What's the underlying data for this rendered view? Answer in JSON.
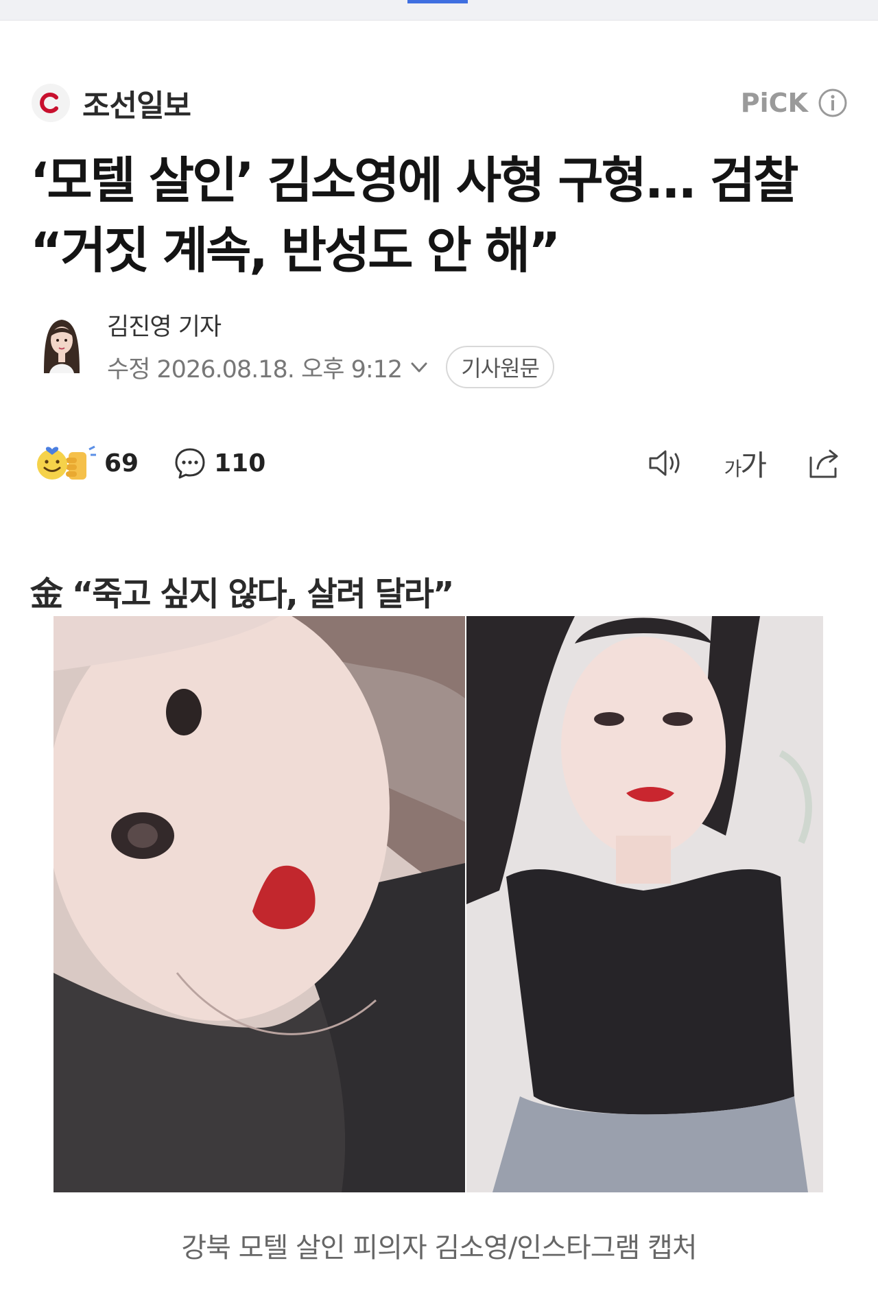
{
  "press": {
    "name": "조선일보",
    "pick_label": "PiCK"
  },
  "article": {
    "headline_line1": "‘모텔 살인’ 김소영에 사형 구형... 검찰",
    "headline_line2": "“거짓 계속, 반성도 안 해”",
    "author": "김진영 기자",
    "modified_prefix": "수정",
    "modified_datetime": "2026.08.18. 오후 9:12",
    "original_button": "기사원문"
  },
  "actions": {
    "reaction_count": "69",
    "comment_count": "110",
    "font_small": "가",
    "font_large": "가"
  },
  "body": {
    "subheading": "金 “죽고 싶지 않다, 살려 달라”",
    "photo_caption": "강북 모텔 살인 피의자 김소영/인스타그램 캡처"
  },
  "colors": {
    "accent": "#3f6fe0",
    "logo_red": "#c8102e",
    "pick_gray": "#9a9a9a"
  }
}
